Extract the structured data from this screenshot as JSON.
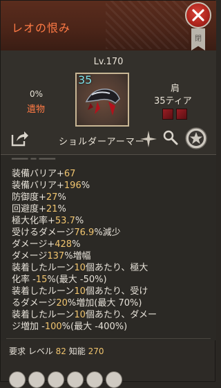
{
  "header": {
    "title": "レオの恨み",
    "bookmark_label": "閉"
  },
  "item": {
    "level": "Lv.170",
    "relic_percent": "0%",
    "relic_label": "遺物",
    "quantity": "35",
    "slot": "肩",
    "tier": "35ティア",
    "name": "ショルダーアーマー"
  },
  "stats": [
    {
      "pre": "装備バリア+",
      "num": "67",
      "post": ""
    },
    {
      "pre": "装備バリア+",
      "num": "196",
      "post": "%"
    },
    {
      "pre": "防御度+",
      "num": "27",
      "post": "%"
    },
    {
      "pre": "回避度+",
      "num": "21",
      "post": "%"
    },
    {
      "pre": "極大化率+",
      "num": "53.7",
      "post": "%"
    },
    {
      "pre": "受けるダメージ",
      "num": "76.9",
      "post": "%減少"
    },
    {
      "pre": "ダメージ+",
      "num": "428",
      "post": "%"
    },
    {
      "pre": "ダメージ",
      "num": "137",
      "post": "%増幅"
    },
    {
      "pre": "装着したルーン",
      "num": "10",
      "post": "個あたり、極大"
    },
    {
      "pre": "化率 -",
      "num": "15",
      "post": "%(最大 -50%)"
    },
    {
      "pre": "装着したルーン",
      "num": "10",
      "post": "個あたり、受け"
    },
    {
      "pre": "るダメージ",
      "num": "20",
      "post": "%増加(最大 70%)"
    },
    {
      "pre": "装着したルーン",
      "num": "10",
      "post": "個あたり、ダメー"
    },
    {
      "pre": "ジ増加 -",
      "num": "100",
      "post": "%(最大 -400%)"
    }
  ],
  "requirements": {
    "label": "要求 レベル",
    "level": "82",
    "int_label": "知能",
    "int": "270"
  },
  "colors": {
    "accent": "#ff7a45",
    "stat_number": "#f1c56f",
    "quantity": "#7fe1e8"
  },
  "icons": [
    "close-icon",
    "bookmark-icon",
    "share-icon",
    "sparkle-icon",
    "magnify-icon",
    "star-icon"
  ]
}
